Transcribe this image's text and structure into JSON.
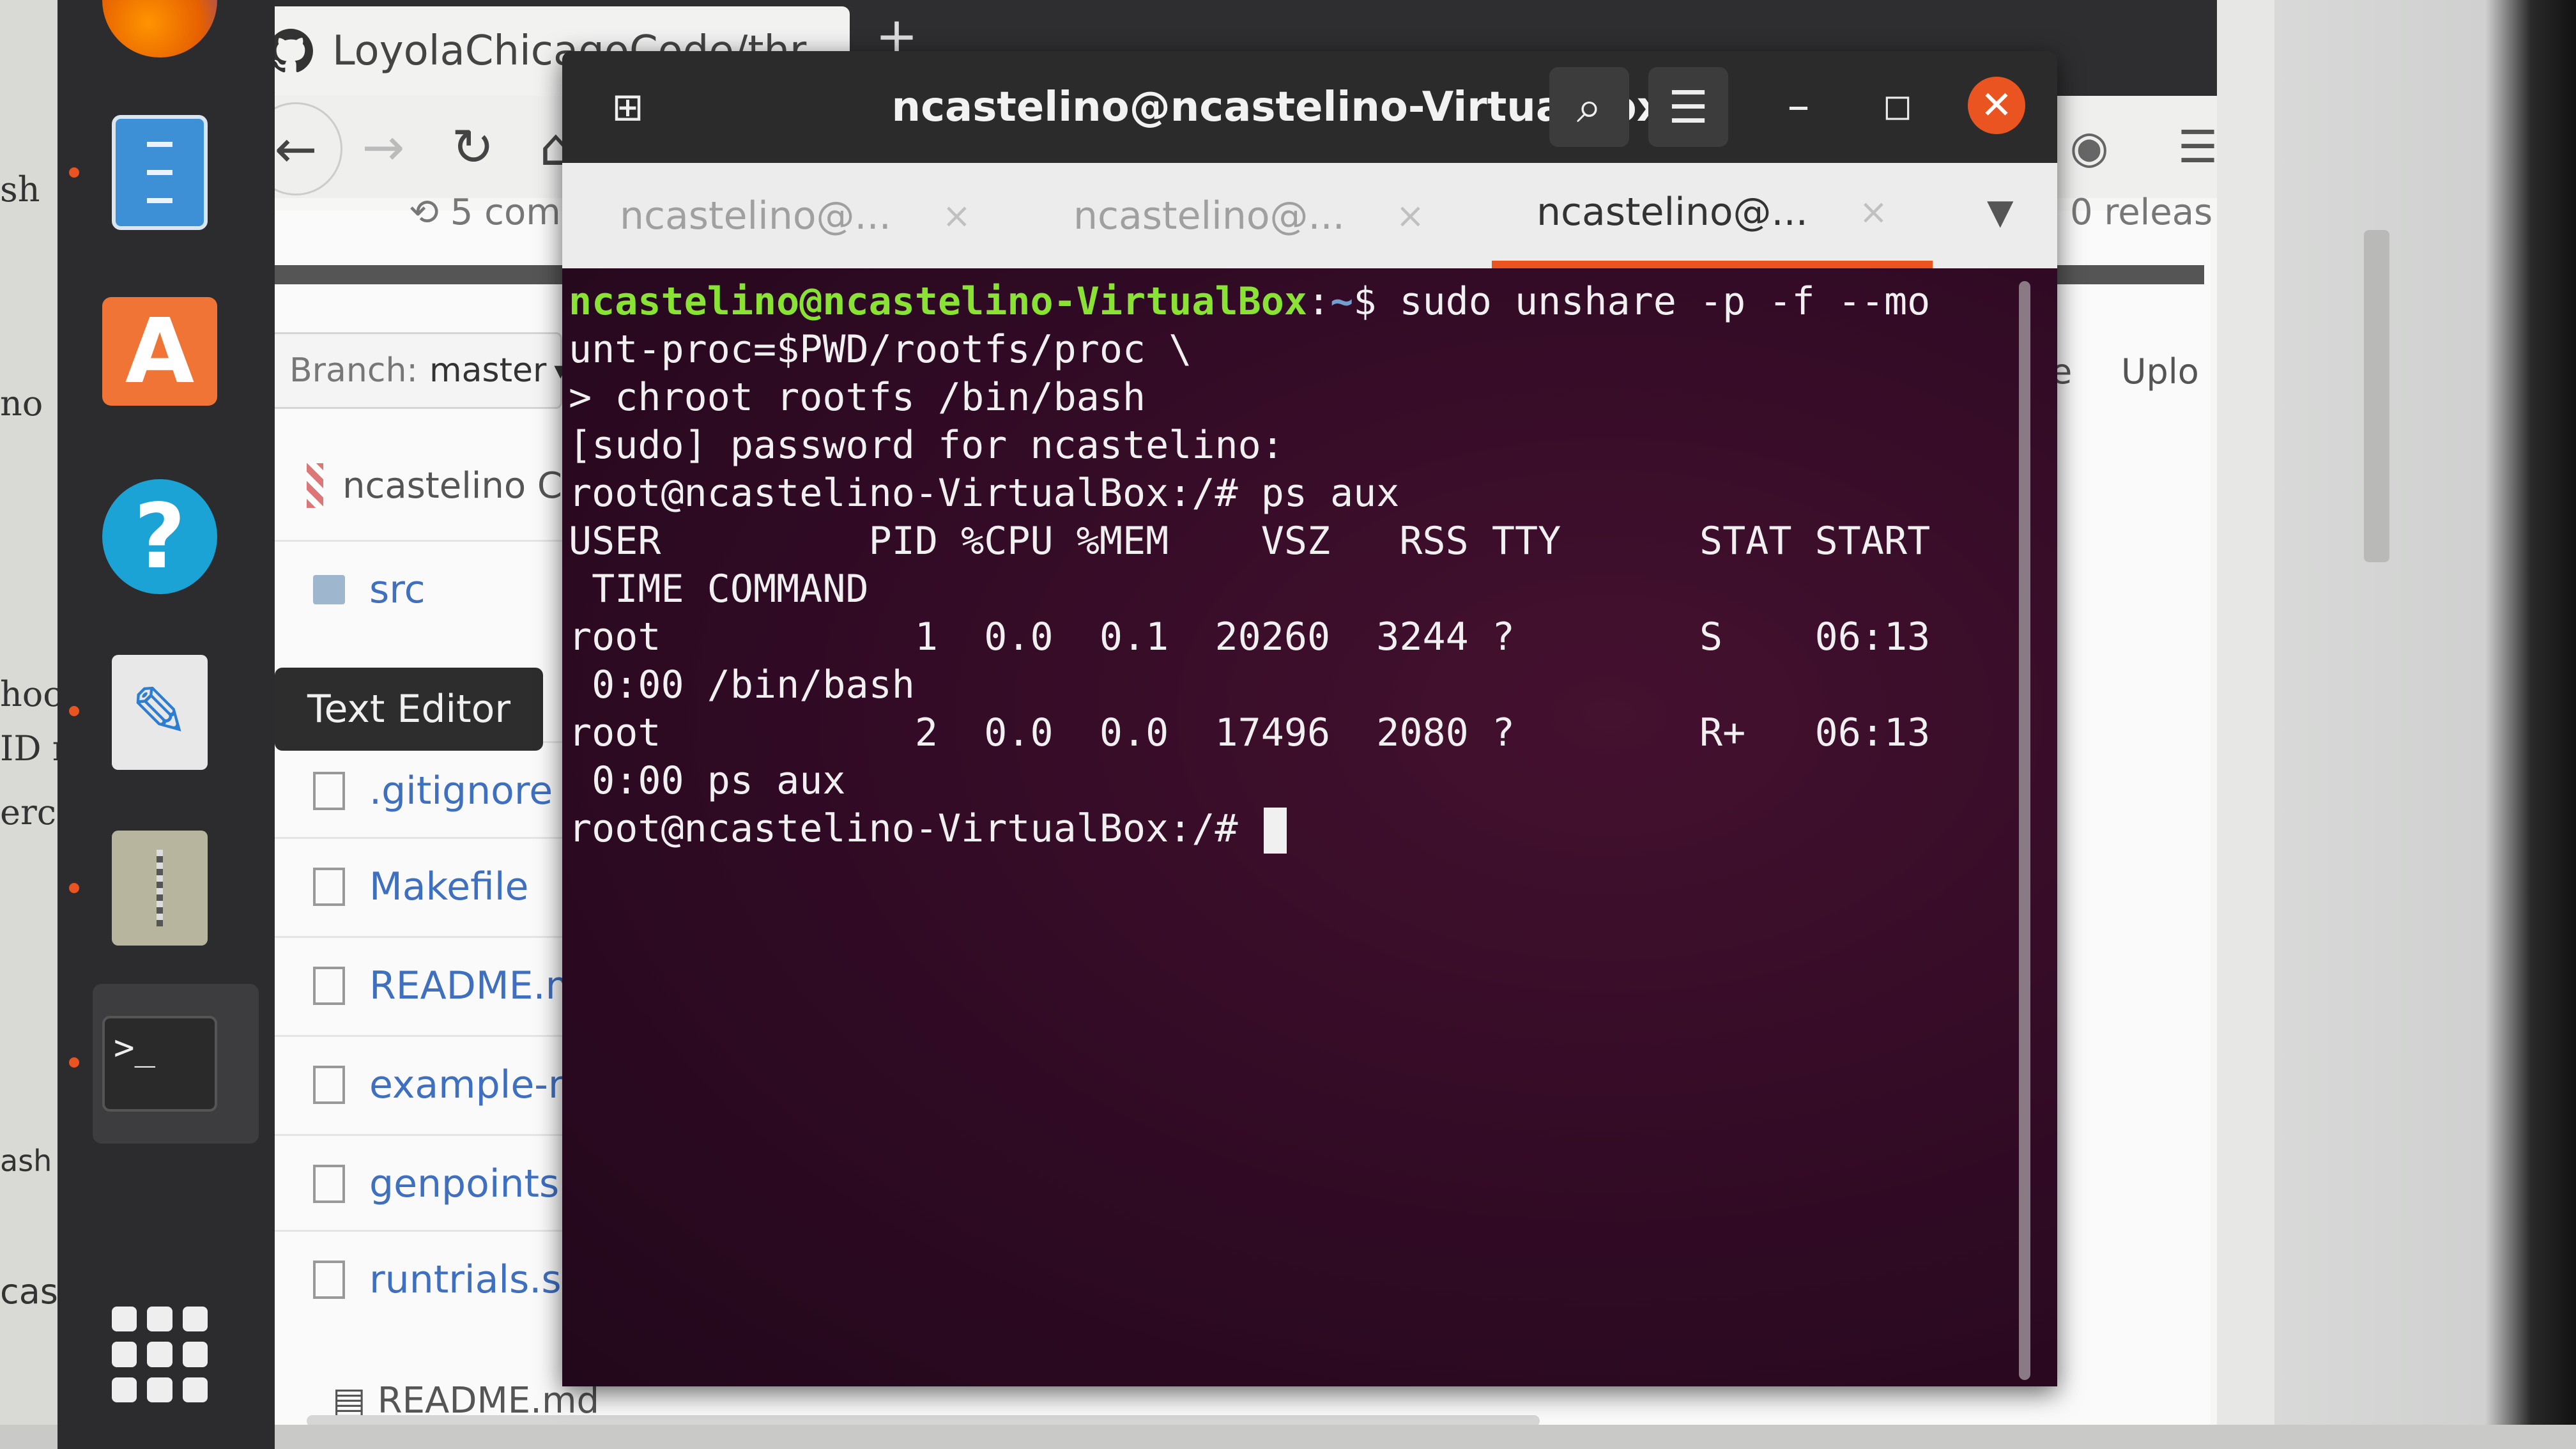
{
  "left_doc": {
    "fragments": [
      "sh",
      "no",
      "hoc",
      "ID n",
      "erc",
      "ash",
      "case,"
    ]
  },
  "dock": {
    "items": [
      {
        "name": "firefox-icon"
      },
      {
        "name": "files-icon"
      },
      {
        "name": "software-center-icon"
      },
      {
        "name": "help-icon"
      },
      {
        "name": "text-editor-icon"
      },
      {
        "name": "archive-icon"
      },
      {
        "name": "terminal-icon"
      },
      {
        "name": "show-apps-icon"
      }
    ],
    "tooltip": "Text Editor"
  },
  "browser": {
    "tab_title": "LoyolaChicagoCode/thr",
    "tab_close": "×",
    "new_tab": "+",
    "commits_fragment": "5 com",
    "releases_fragment": "0 releas",
    "branch_label": "Branch:",
    "branch_value": "master",
    "commit_author": "ncastelino C",
    "files": [
      {
        "name": "src",
        "type": "folder"
      },
      {
        "name": ".gitignore",
        "type": "file"
      },
      {
        "name": "Makefile",
        "type": "file"
      },
      {
        "name": "README.m",
        "type": "file"
      },
      {
        "name": "example-mu",
        "type": "file"
      },
      {
        "name": "genpoints.py",
        "type": "file"
      },
      {
        "name": "runtrials.sh",
        "type": "file"
      }
    ],
    "readme_header": "README.md",
    "right_button_fragment_1": "e",
    "right_button_fragment_2": "Uplo"
  },
  "terminal": {
    "title": "ncastelino@ncastelino-VirtualBox: ~",
    "tabs": [
      {
        "label": "ncastelino@...",
        "active": false
      },
      {
        "label": "ncastelino@...",
        "active": false
      },
      {
        "label": "ncastelino@...",
        "active": true
      }
    ],
    "tab_close": "×",
    "lines": {
      "l1_user": "ncastelino@ncastelino-VirtualBox",
      "l1_colon": ":",
      "l1_path": "~",
      "l1_cmd": "$ sudo unshare -p -f --mo",
      "l2": "unt-proc=$PWD/rootfs/proc \\",
      "l3": "> chroot rootfs /bin/bash",
      "l4": "[sudo] password for ncastelino:",
      "l5": "root@ncastelino-VirtualBox:/# ps aux",
      "l6": "USER         PID %CPU %MEM    VSZ   RSS TTY      STAT START",
      "l7": " TIME COMMAND",
      "l8": "root           1  0.0  0.1  20260  3244 ?        S    06:13",
      "l9": " 0:00 /bin/bash",
      "l10": "root           2  0.0  0.0  17496  2080 ?        R+   06:13",
      "l11": " 0:00 ps aux",
      "l12": "root@ncastelino-VirtualBox:/# "
    }
  }
}
